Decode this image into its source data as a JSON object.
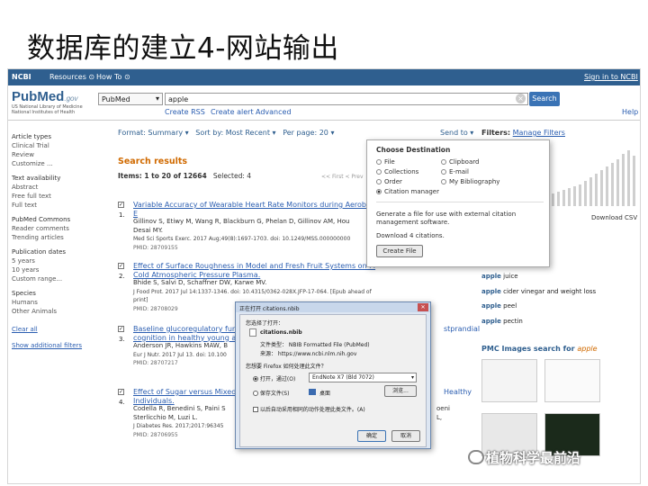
{
  "slide": {
    "title": "数据库的建立4-网站输出"
  },
  "ncbi_bar": {
    "logo": "NCBI",
    "resources": "Resources ⊙",
    "howto": "How To ⊙",
    "signin": "Sign in to NCBI"
  },
  "pubmed": {
    "logo": "PubMed",
    "logo_gov": ".gov",
    "sub1": "US National Library of Medicine",
    "sub2": "National Institutes of Health",
    "db": "PubMed",
    "query": "apple",
    "search_btn": "Search",
    "links": [
      "Create RSS",
      "Create alert",
      "Advanced"
    ],
    "help": "Help"
  },
  "sidebar": {
    "groups": [
      {
        "head": "Article types",
        "items": [
          "Clinical Trial",
          "Review",
          "Customize ..."
        ]
      },
      {
        "head": "Text availability",
        "items": [
          "Abstract",
          "Free full text",
          "Full text"
        ]
      },
      {
        "head": "PubMed Commons",
        "items": [
          "Reader comments",
          "Trending articles"
        ]
      },
      {
        "head": "Publication dates",
        "items": [
          "5 years",
          "10 years",
          "Custom range..."
        ]
      },
      {
        "head": "Species",
        "items": [
          "Humans",
          "Other Animals"
        ]
      }
    ],
    "clear_all": "Clear all",
    "show_filters": "Show additional filters"
  },
  "toolbar": {
    "format": "Format: Summary ▾",
    "sort": "Sort by: Most Recent ▾",
    "perpage": "Per page: 20 ▾",
    "sendto": "Send to ▾",
    "filters_label": "Filters:",
    "filters_link": "Manage Filters"
  },
  "results": {
    "title": "Search results",
    "items": "Items: 1 to 20 of 12664",
    "selected": "Selected: 4",
    "pager": "<< First  < Prev",
    "records": [
      {
        "num": "1.",
        "title": "Variable Accuracy of Wearable Heart Rate Monitors during Aerobic E",
        "authors": "Gillinov S, Etiwy M, Wang R, Blackburn G, Phelan D, Gillinov AM, Hou",
        "authors2": "Desai MY.",
        "journal": "Med Sci Sports Exerc. 2017 Aug;49(8):1697-1703. doi: 10.1249/MSS.000000000",
        "pmid": "PMID: 28709155"
      },
      {
        "num": "2.",
        "title": "Effect of Surface Roughness in Model and Fresh Fruit Systems on M",
        "title2": "Cold Atmospheric Pressure Plasma.",
        "authors": "Bhide S, Salvi D, Schaffner DW, Karwe MV.",
        "journal": "J Food Prot. 2017 Jul 14:1337-1346. doi: 10.4315/0362-028X.JFP-17-064. [Epub ahead of print]",
        "pmid": "PMID: 28708029"
      },
      {
        "num": "3.",
        "title": "Baseline glucoregulatory func",
        "title_tail": "stprandial",
        "title2": "cognition in healthy young ad",
        "authors": "Anderson JR, Hawkins MAW, B",
        "journal": "Eur J Nutr. 2017 Jul 13. doi: 10.100",
        "pmid": "PMID: 28707217"
      },
      {
        "num": "4.",
        "title": "Effect of Sugar versus Mixed",
        "title_tail": "Healthy",
        "title2": "Individuals.",
        "authors": "Codella R, Benedini S, Paini S",
        "authors_tail": "oeni L,",
        "authors2": "Sterlicchio M, Luzi L.",
        "journal": "J Diabetes Res. 2017;2017:96345",
        "pmid": "PMID: 28706955"
      }
    ]
  },
  "send_popup": {
    "title": "Choose Destination",
    "options": [
      "File",
      "Clipboard",
      "Collections",
      "E-mail",
      "Order",
      "My Bibliography",
      "Citation manager"
    ],
    "selected": "Citation manager",
    "desc": "Generate a file for use with external citation management software.",
    "count": "Download 4 citations.",
    "button": "Create File"
  },
  "right_panel": {
    "download": "Download CSV",
    "suggestions": [
      {
        "bold": "apple",
        "rest": " juice"
      },
      {
        "bold": "apple",
        "rest": " cider vinegar and weight loss"
      },
      {
        "bold": "apple",
        "rest": " peel"
      },
      {
        "bold": "apple",
        "rest": " pectin"
      }
    ],
    "pmc_label": "PMC Images search for",
    "pmc_query": "apple"
  },
  "dialog": {
    "title": "正在打开 citations.nbib",
    "prompt": "您选择了打开：",
    "file": "citations.nbib",
    "type": "文件类型： NBIB Formatted File (PubMed)",
    "from": "来源： https://www.ncbi.nlm.nih.gov",
    "question": "您想要 Firefox 如何处理此文件？",
    "open_with": "打开，通过(O)",
    "app": "EndNote X7 (Bld 7072)",
    "save": "保存文件(S)",
    "desktop": "桌面",
    "browse": "浏览...",
    "remember": "以后自动采用相同的动作处理此类文件。(A)",
    "ok": "确定",
    "cancel": "取消"
  },
  "watermark": {
    "text": "植物科学最前沿"
  }
}
